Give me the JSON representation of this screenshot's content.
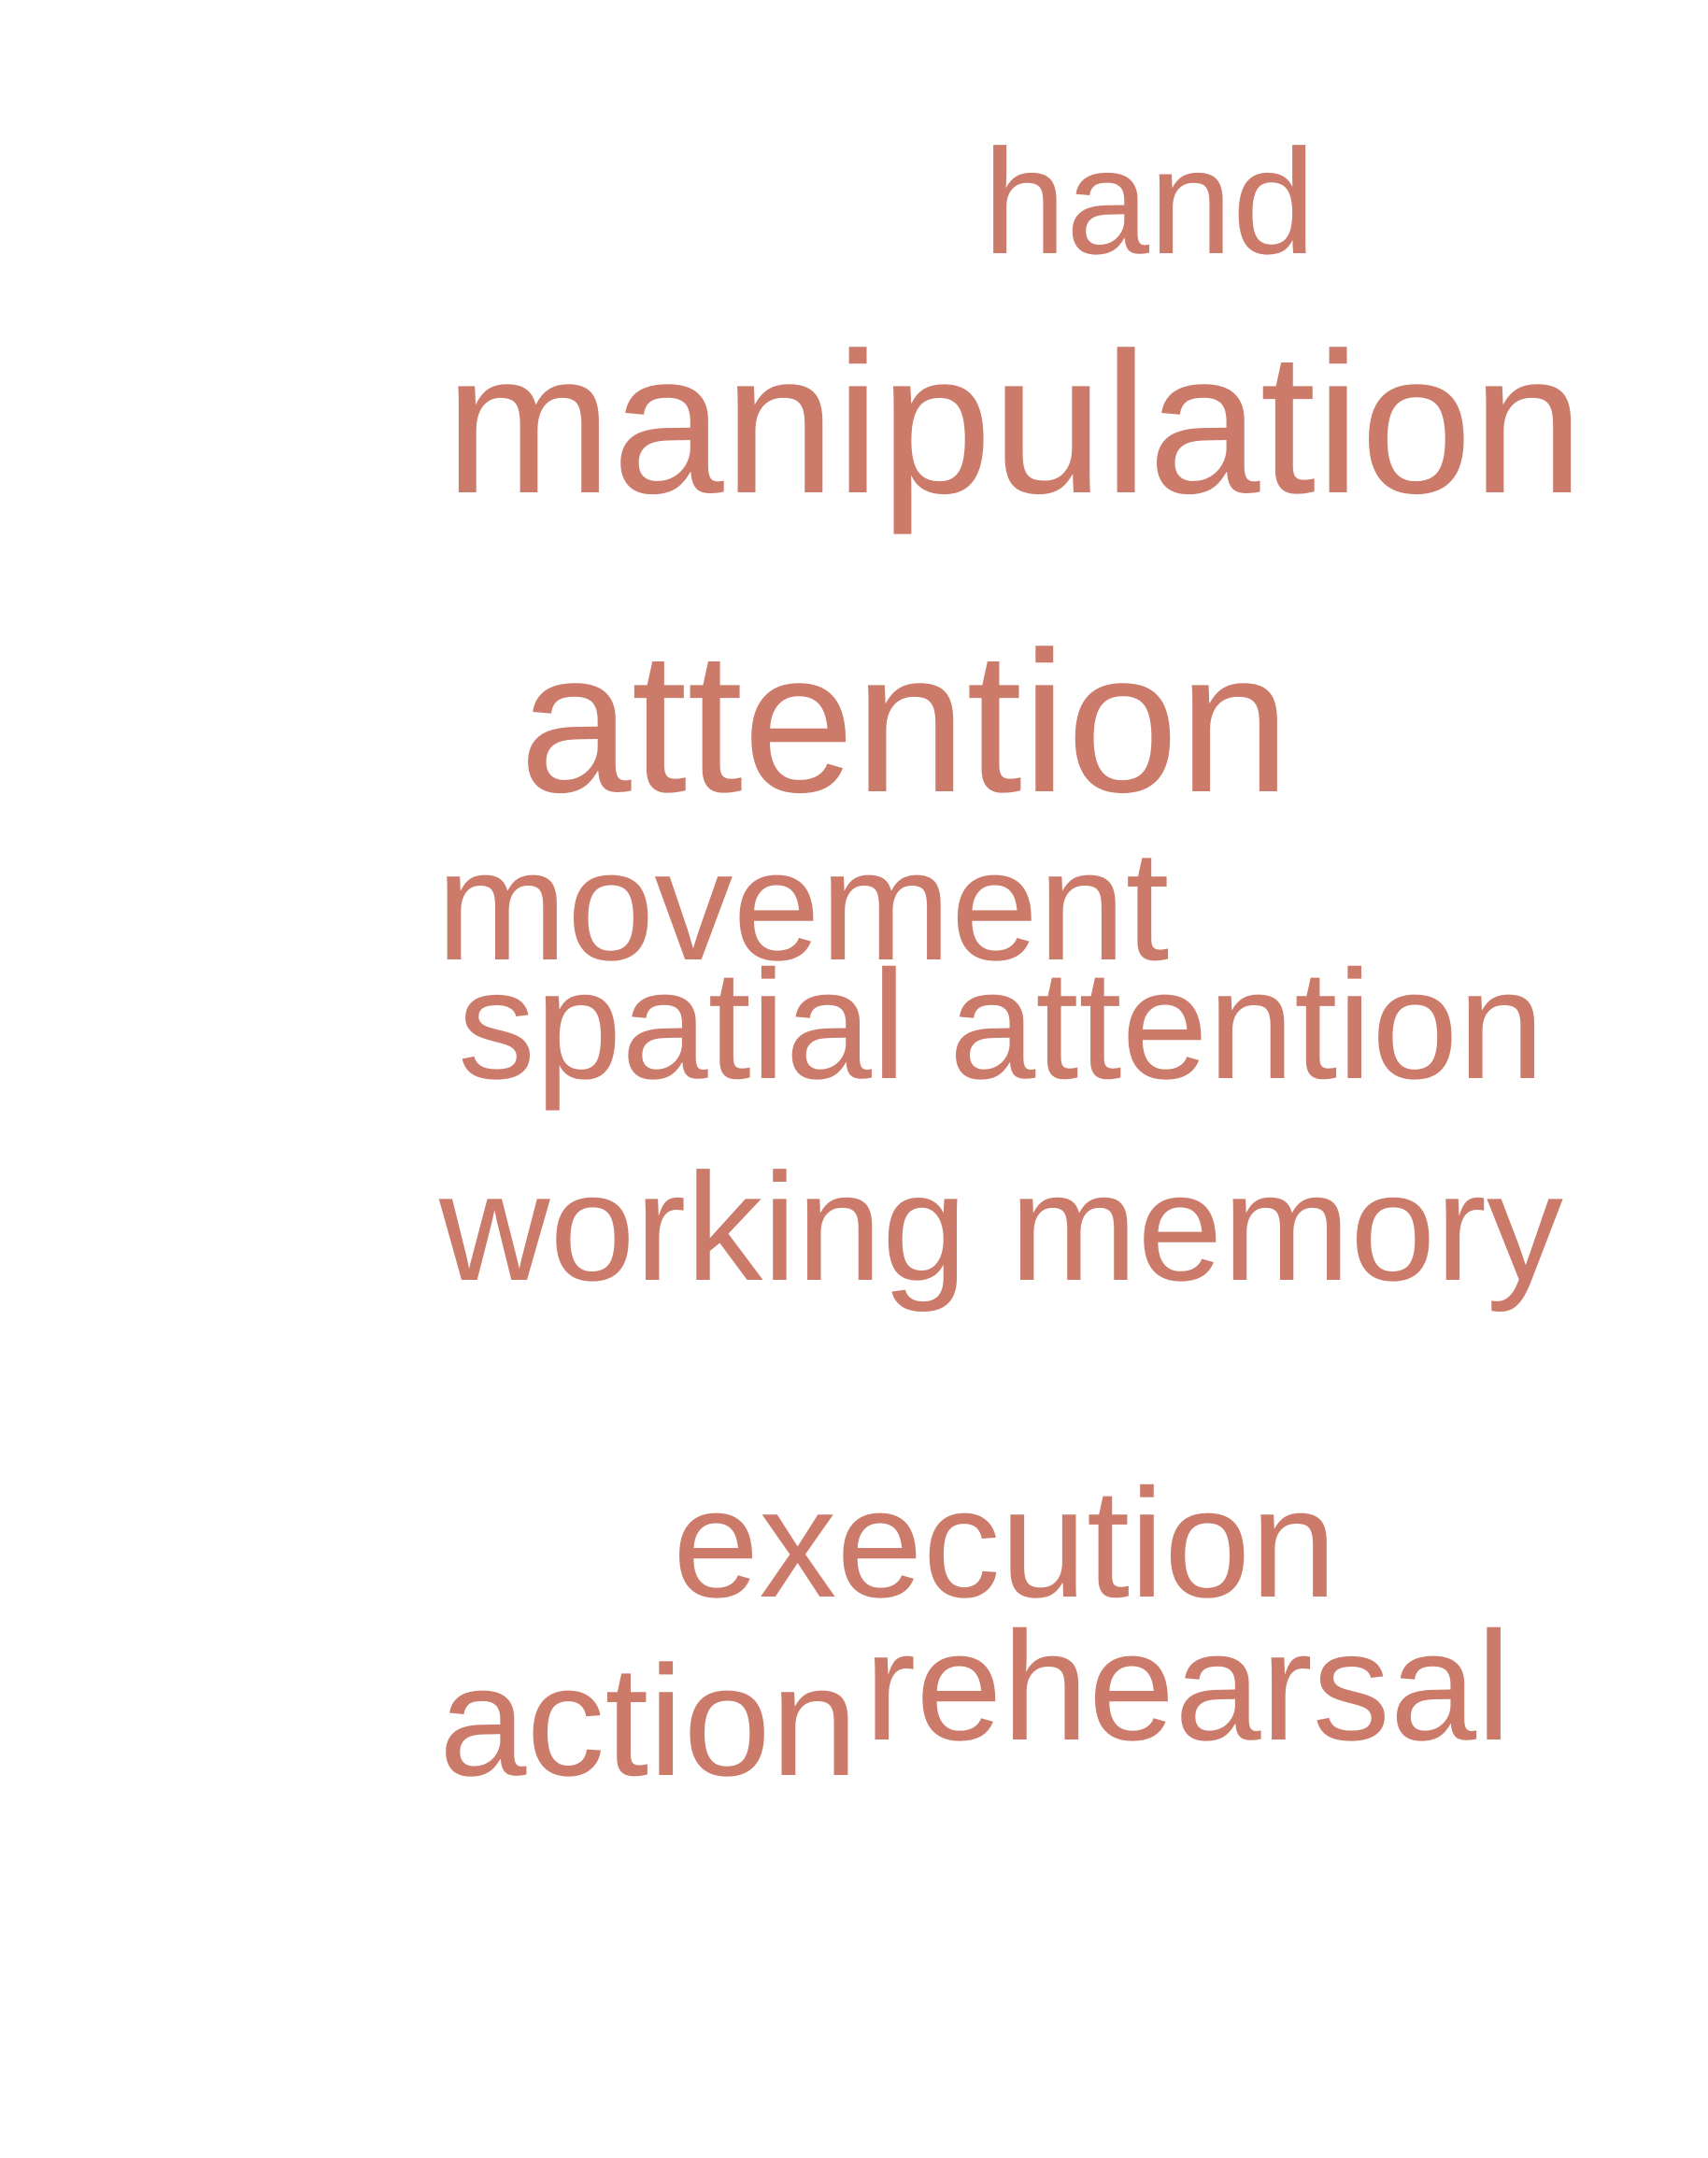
{
  "style": {
    "word_color": "#cc7a6a",
    "background": "#ffffff"
  },
  "words": {
    "hand": "hand",
    "manipulation": "manipulation",
    "attention": "attention",
    "movement": "movement",
    "spatial_attention": "spatial attention",
    "working_memory": "working memory",
    "execution": "execution",
    "rehearsal": "rehearsal",
    "action": "action"
  }
}
